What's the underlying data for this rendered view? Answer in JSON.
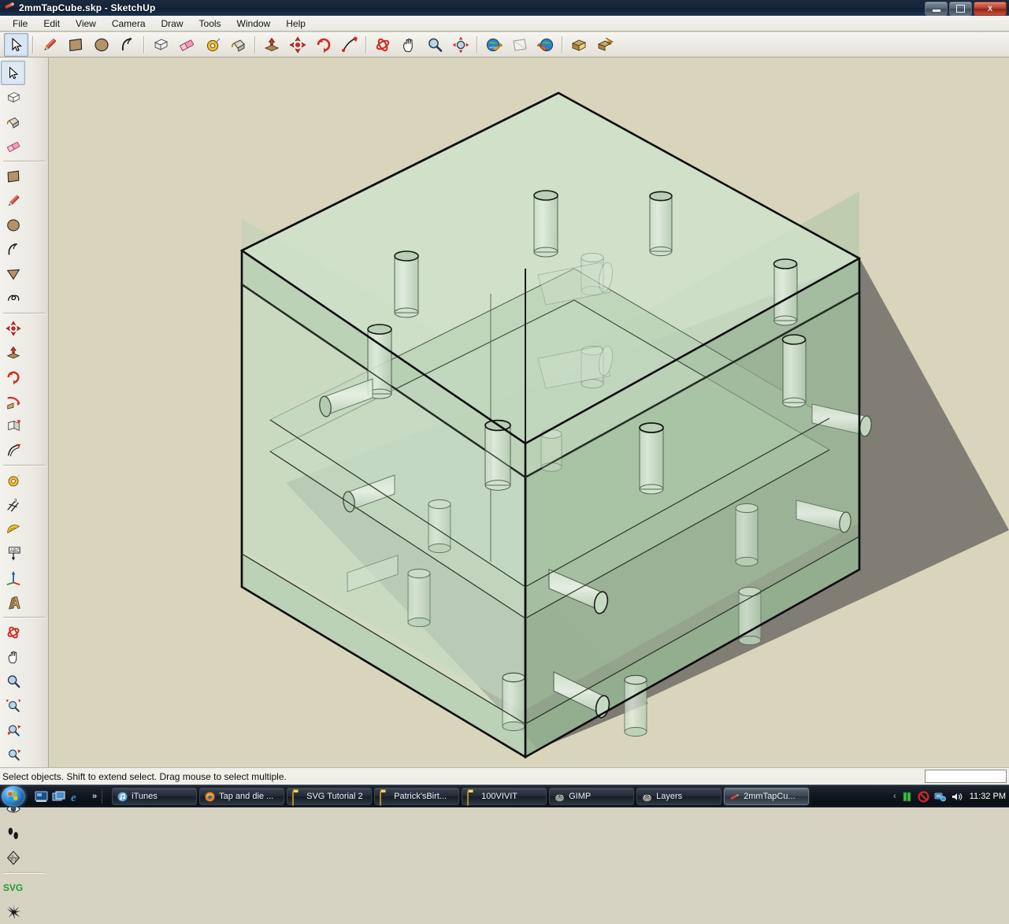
{
  "window": {
    "title": "2mmTapCube.skp - SketchUp",
    "icon": "sketchup-pencil-icon",
    "controls": {
      "minimize": "minimize-button",
      "maximize": "maximize-button",
      "close_label": "X"
    }
  },
  "menubar": {
    "items": [
      {
        "label": "File"
      },
      {
        "label": "Edit"
      },
      {
        "label": "View"
      },
      {
        "label": "Camera"
      },
      {
        "label": "Draw"
      },
      {
        "label": "Tools"
      },
      {
        "label": "Window"
      },
      {
        "label": "Help"
      }
    ]
  },
  "toolbar": {
    "groups": [
      {
        "tools": [
          {
            "name": "select-tool",
            "icon": "arrow-cursor-icon",
            "active": true
          }
        ]
      },
      {
        "tools": [
          {
            "name": "line-tool",
            "icon": "pencil-icon",
            "active": false
          },
          {
            "name": "rectangle-tool",
            "icon": "rectangle-icon",
            "active": false
          },
          {
            "name": "circle-tool",
            "icon": "circle-icon",
            "active": false
          },
          {
            "name": "arc-tool",
            "icon": "arc-icon",
            "active": false
          }
        ]
      },
      {
        "tools": [
          {
            "name": "make-component-tool",
            "icon": "component-box-icon",
            "active": false
          },
          {
            "name": "eraser-tool",
            "icon": "eraser-icon",
            "active": false
          },
          {
            "name": "tape-measure-tool",
            "icon": "tape-measure-icon",
            "active": false
          },
          {
            "name": "paint-bucket-tool",
            "icon": "paint-bucket-icon",
            "active": false
          }
        ]
      },
      {
        "tools": [
          {
            "name": "push-pull-tool",
            "icon": "push-pull-icon",
            "active": false
          },
          {
            "name": "move-tool",
            "icon": "move-cross-icon",
            "active": false
          },
          {
            "name": "rotate-tool",
            "icon": "rotate-arrows-icon",
            "active": false
          },
          {
            "name": "scale-tool",
            "icon": "scale-icon",
            "active": false
          }
        ]
      },
      {
        "tools": [
          {
            "name": "orbit-tool",
            "icon": "orbit-icon",
            "active": false
          },
          {
            "name": "pan-tool",
            "icon": "hand-pan-icon",
            "active": false
          },
          {
            "name": "zoom-tool",
            "icon": "magnifier-icon",
            "active": false
          },
          {
            "name": "zoom-extents-tool",
            "icon": "zoom-extents-icon",
            "active": false
          }
        ]
      },
      {
        "tools": [
          {
            "name": "previous-view-button",
            "icon": "globe-back-icon",
            "active": false
          },
          {
            "name": "window-view-button",
            "icon": "view-window-icon",
            "active": false
          },
          {
            "name": "next-view-button",
            "icon": "globe-forward-icon",
            "active": false
          }
        ]
      },
      {
        "tools": [
          {
            "name": "section-plane-tool",
            "icon": "section-plane-icon",
            "active": false
          },
          {
            "name": "section-cut-tool",
            "icon": "section-cut-icon",
            "active": false
          }
        ]
      }
    ]
  },
  "sidebar": {
    "groups": [
      {
        "tools": [
          {
            "name": "select-tool",
            "icon": "arrow-cursor-icon",
            "active": true
          },
          {
            "name": "make-component-tool",
            "icon": "component-box-icon",
            "active": false
          },
          {
            "name": "paint-bucket-tool",
            "icon": "paint-bucket-icon",
            "active": false
          },
          {
            "name": "eraser-tool",
            "icon": "eraser-icon",
            "active": false
          }
        ]
      },
      {
        "tools": [
          {
            "name": "rectangle-tool",
            "icon": "rectangle-icon",
            "active": false
          },
          {
            "name": "line-tool",
            "icon": "pencil-icon",
            "active": false
          },
          {
            "name": "circle-tool",
            "icon": "circle-icon",
            "active": false
          },
          {
            "name": "arc-tool",
            "icon": "arc-icon",
            "active": false
          },
          {
            "name": "polygon-tool",
            "icon": "polygon-triangle-icon",
            "active": false
          },
          {
            "name": "freehand-tool",
            "icon": "freehand-squiggle-icon",
            "active": false
          }
        ]
      },
      {
        "tools": [
          {
            "name": "move-tool",
            "icon": "move-cross-icon",
            "active": false
          },
          {
            "name": "push-pull-tool",
            "icon": "push-pull-icon",
            "active": false
          },
          {
            "name": "rotate-tool",
            "icon": "rotate-arrows-icon",
            "active": false
          },
          {
            "name": "follow-me-tool",
            "icon": "follow-me-icon",
            "active": false
          },
          {
            "name": "scale-tool",
            "icon": "scale-icon",
            "active": false
          },
          {
            "name": "offset-tool",
            "icon": "offset-arc-icon",
            "active": false
          }
        ]
      },
      {
        "tools": [
          {
            "name": "tape-measure-tool",
            "icon": "tape-measure-icon",
            "active": false
          },
          {
            "name": "dimension-tool",
            "icon": "dimension-icon",
            "active": false
          },
          {
            "name": "protractor-tool",
            "icon": "protractor-icon",
            "active": false
          },
          {
            "name": "text-tool",
            "icon": "abc-text-icon",
            "active": false
          },
          {
            "name": "axes-tool",
            "icon": "axes-icon",
            "active": false
          },
          {
            "name": "three-d-text-tool",
            "icon": "3d-text-a-icon",
            "active": false
          }
        ]
      },
      {
        "tools": [
          {
            "name": "orbit-tool",
            "icon": "orbit-icon",
            "active": false
          },
          {
            "name": "pan-tool",
            "icon": "hand-pan-icon",
            "active": false
          },
          {
            "name": "zoom-tool",
            "icon": "magnifier-icon",
            "active": false
          },
          {
            "name": "zoom-window-tool",
            "icon": "zoom-window-icon",
            "active": false
          },
          {
            "name": "zoom-extents-tool",
            "icon": "zoom-extents-icon",
            "active": false
          },
          {
            "name": "previous-view-button",
            "icon": "previous-view-icon",
            "active": false
          }
        ]
      },
      {
        "tools": [
          {
            "name": "position-camera-tool",
            "icon": "position-camera-icon",
            "active": false
          },
          {
            "name": "look-around-tool",
            "icon": "eye-look-icon",
            "active": false
          },
          {
            "name": "walk-tool",
            "icon": "footprints-walk-icon",
            "active": false
          },
          {
            "name": "section-display-tool",
            "icon": "section-compass-icon",
            "active": false
          }
        ]
      },
      {
        "tools": [
          {
            "name": "svg-export-tool",
            "icon": "svg-text-icon",
            "label": "SVG",
            "active": false
          },
          {
            "name": "splat-tool",
            "icon": "splat-star-icon",
            "active": false
          }
        ]
      }
    ]
  },
  "viewport": {
    "name": "3d-model-viewport",
    "background_color": "#d9d5bc",
    "shadow_color": "#807d74",
    "model": {
      "name": "2mmTapCube",
      "face_color": "#c7dcc4",
      "edge_color": "#1a1a1a",
      "description": "Translucent green cube with tapped cylindrical holes on all faces"
    }
  },
  "statusbar": {
    "message": "Select objects. Shift to extend select. Drag mouse to select multiple.",
    "vcb_value": "",
    "vcb_placeholder": ""
  },
  "taskbar": {
    "start_label": "Start",
    "quicklaunch": [
      {
        "name": "show-desktop-icon"
      },
      {
        "name": "switch-windows-icon"
      },
      {
        "name": "internet-explorer-icon"
      }
    ],
    "overflow_label": "»",
    "tasks": [
      {
        "label": "iTunes",
        "icon": "itunes-icon",
        "active": false
      },
      {
        "label": "Tap and die ...",
        "icon": "firefox-icon",
        "active": false
      },
      {
        "label": "SVG Tutorial 2",
        "icon": "folder-icon",
        "active": false
      },
      {
        "label": "Patrick'sBirt...",
        "icon": "folder-icon",
        "active": false
      },
      {
        "label": "100VIVIT",
        "icon": "folder-icon",
        "active": false
      },
      {
        "label": "GIMP",
        "icon": "gimp-icon",
        "active": false
      },
      {
        "label": "Layers",
        "icon": "gimp-icon",
        "active": false
      },
      {
        "label": "2mmTapCu...",
        "icon": "sketchup-pencil-icon",
        "active": true
      }
    ],
    "tray": {
      "expand_label": "‹",
      "icons": [
        {
          "name": "battery-icon"
        },
        {
          "name": "action-blocked-icon"
        },
        {
          "name": "network-icon"
        },
        {
          "name": "volume-icon"
        }
      ],
      "clock": "11:32 PM"
    }
  }
}
